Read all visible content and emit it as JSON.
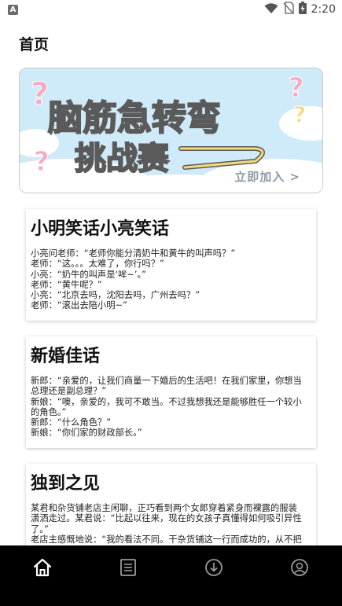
{
  "status_bar": {
    "notification_badge": "A",
    "time": "2:20"
  },
  "page": {
    "title": "首页"
  },
  "banner": {
    "line1": "脑筋急转弯",
    "line2": "挑战赛",
    "join_label": "立即加入 >"
  },
  "jokes": [
    {
      "title": "小明笑话小亮笑话",
      "lines": [
        "小亮问老师：“老师你能分清奶牛和黄牛的叫声吗？”",
        "老师：“这。。。太难了，你行吗？”",
        "小亮：“奶牛的叫声是‘哞~’。”",
        "老师：“黄牛呢？”",
        "小亮：“北京去吗，沈阳去吗，广州去吗？”",
        "老师：“滚出去陪小明~”"
      ]
    },
    {
      "title": "新婚佳话",
      "lines": [
        "新郎：“亲爱的，让我们商量一下婚后的生活吧！在我们家里，你想当",
        "总理还是副总理？”",
        "新娘：“噢，亲爱的，我可不敢当。不过我想我还是能够胜任一个较小",
        "的角色。”",
        "新郎：“什么角色？”",
        "新娘：“你们家的财政部长。”"
      ]
    },
    {
      "title": "独到之见",
      "lines": [
        "某君和杂货铺老店主闲聊，正巧看到两个女郎穿着紧身而裸露的服装",
        "潇洒走过。某君说：“比起以往来，现在的女孩子真懂得如何吸引异性",
        "了。”",
        "老店主感慨地说：“我的看法不同。干杂货铺这一行而成功的，从不把"
      ]
    }
  ],
  "bottom_nav": {
    "items": [
      "home-icon",
      "list-icon",
      "download-icon",
      "user-icon"
    ]
  },
  "colors": {
    "nav_background": "#000000",
    "banner_sky": "#c9e8f7",
    "banner_title_pink": "#f7a9c4",
    "banner_title_yellow": "#f7d978"
  }
}
